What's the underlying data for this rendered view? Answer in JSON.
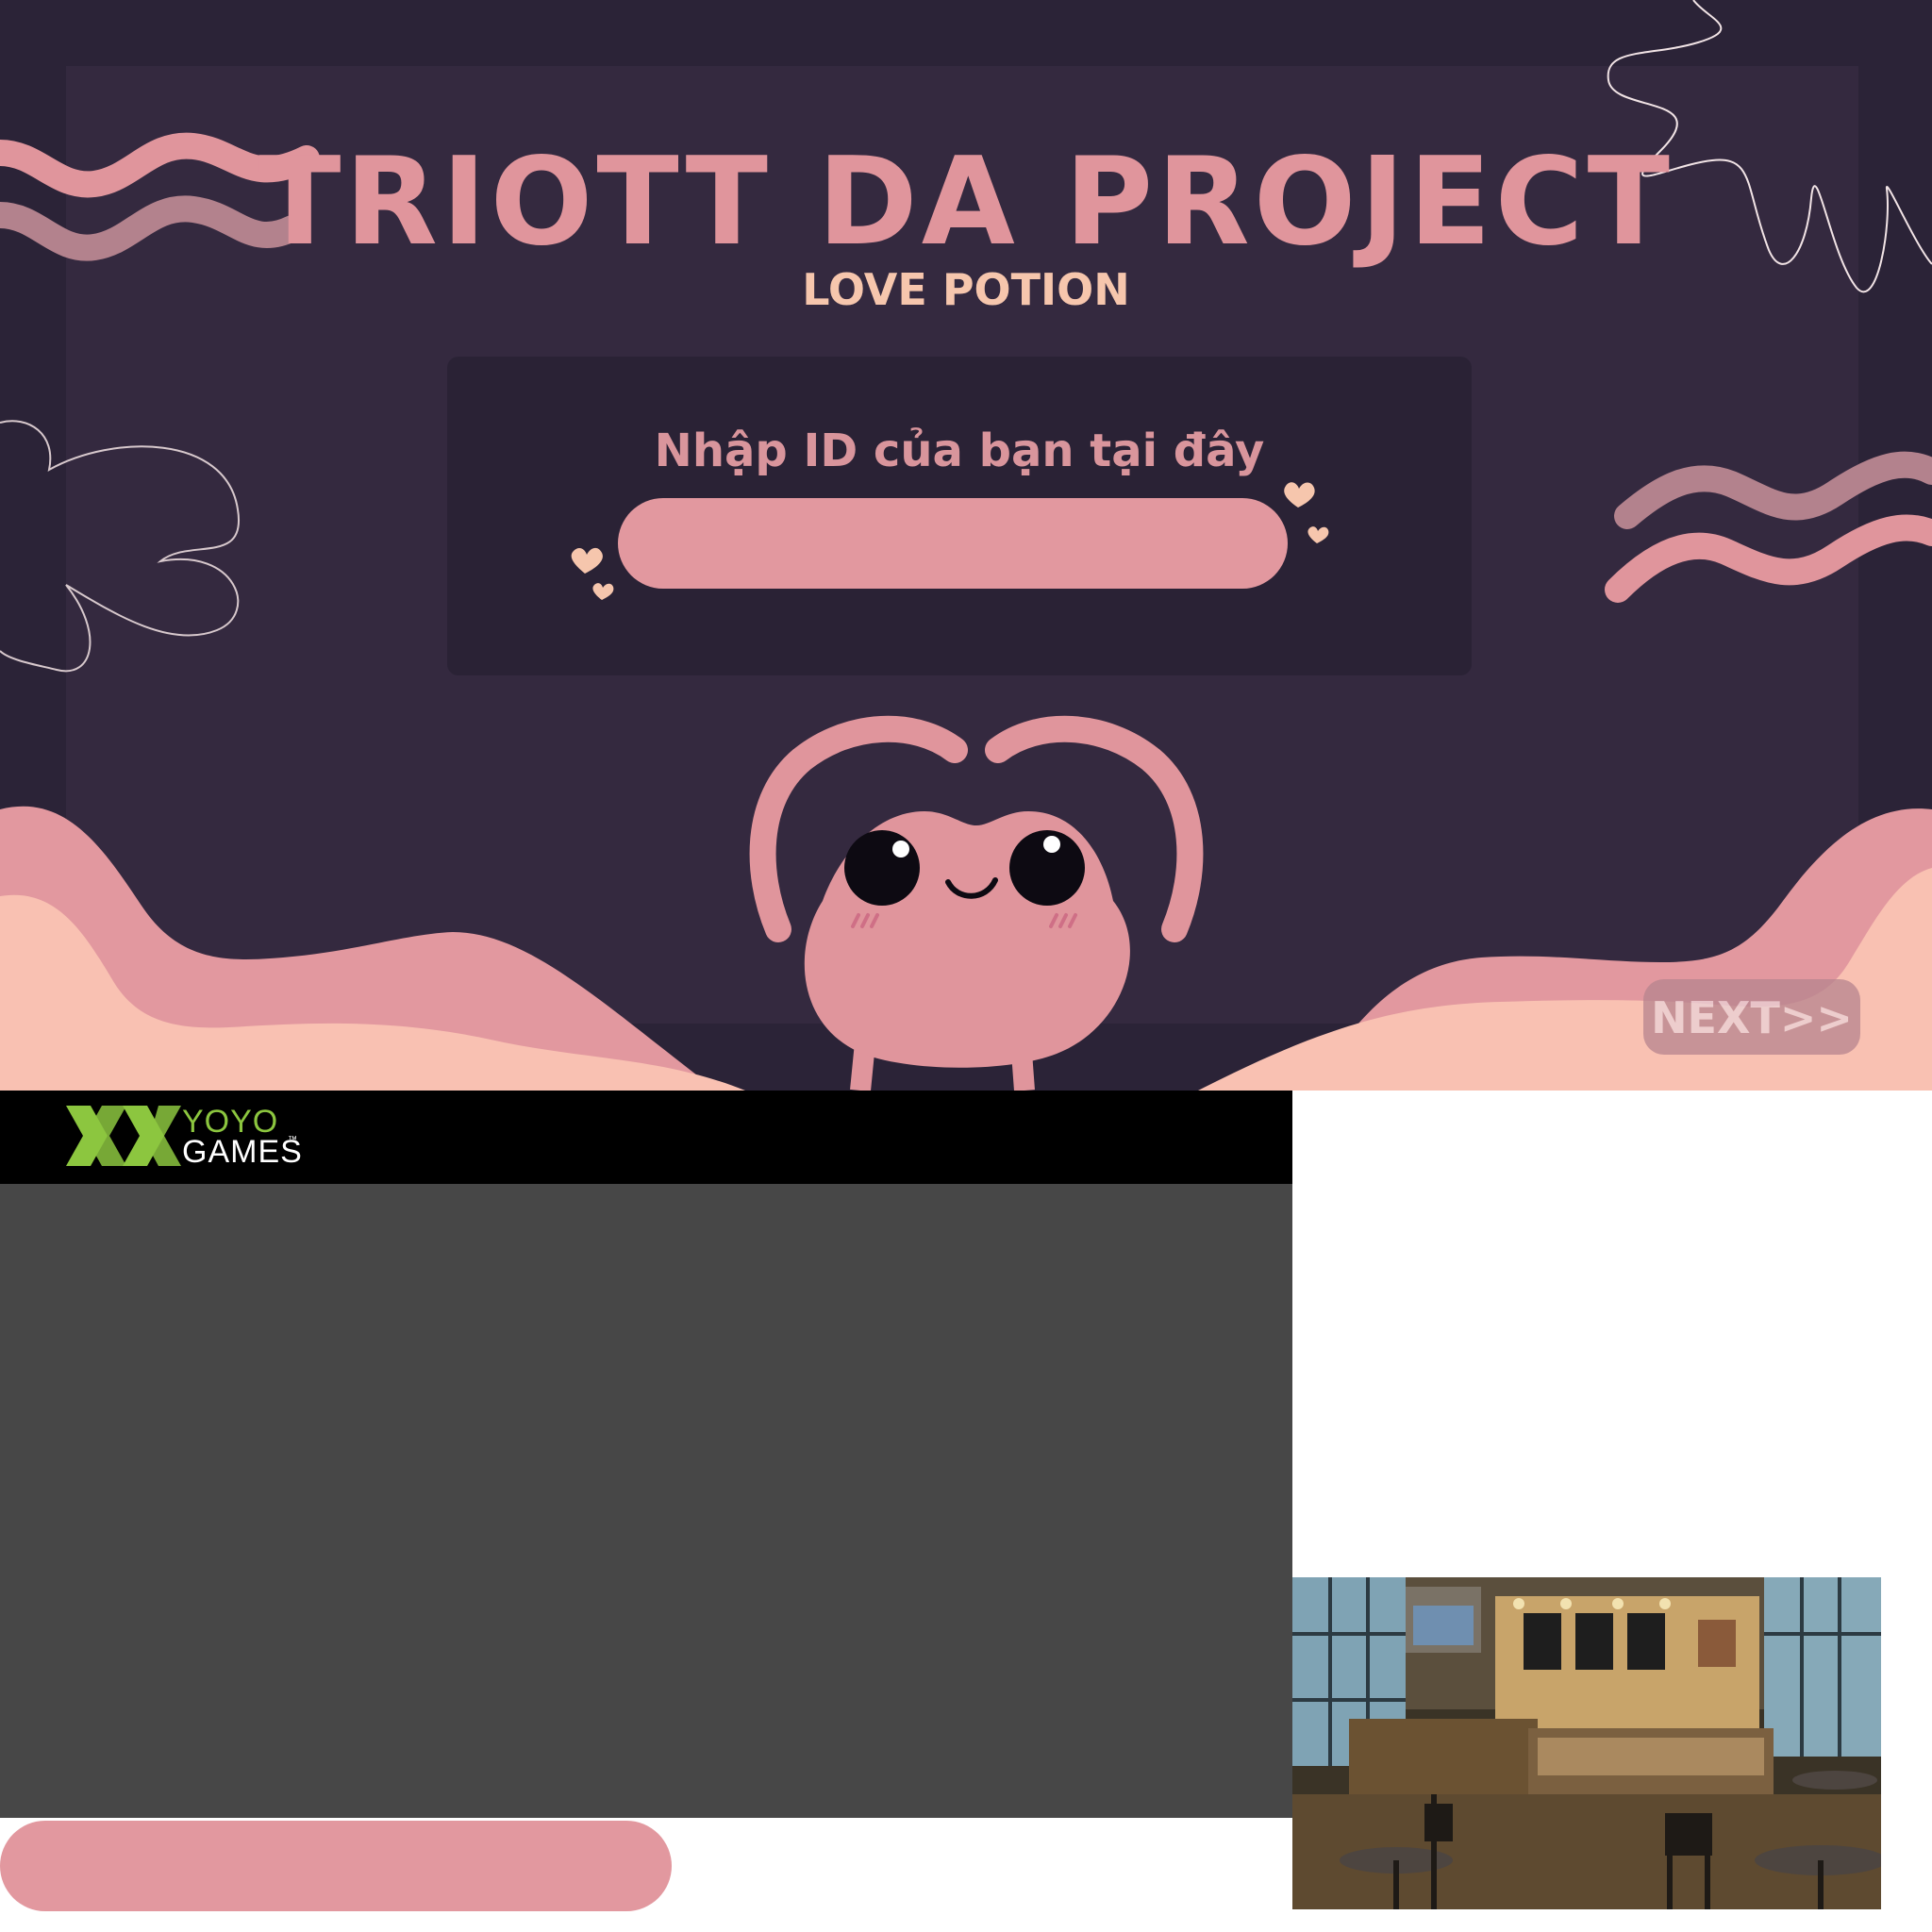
{
  "game": {
    "title": "TRIOTT DA PROJECT",
    "subtitle": "LOVE POTION",
    "id_prompt": "Nhập ID của bạn tại đây",
    "id_input": {
      "value": "",
      "placeholder": ""
    },
    "next_label": "NEXT>>"
  },
  "loader": {
    "brand_line1": "YOYO",
    "brand_line2": "GAMES",
    "trademark": "™"
  },
  "colors": {
    "background": "#2b2337",
    "panel": "#34293f",
    "accent_pink": "#e0959c",
    "peach": "#f6c6ad",
    "yoyo_green": "#8cc63f"
  },
  "icons": [
    "wave-decoration-icon",
    "flower-outline-icon",
    "heart-icon",
    "mascot-heart-creature",
    "yoyo-games-logo-icon"
  ]
}
